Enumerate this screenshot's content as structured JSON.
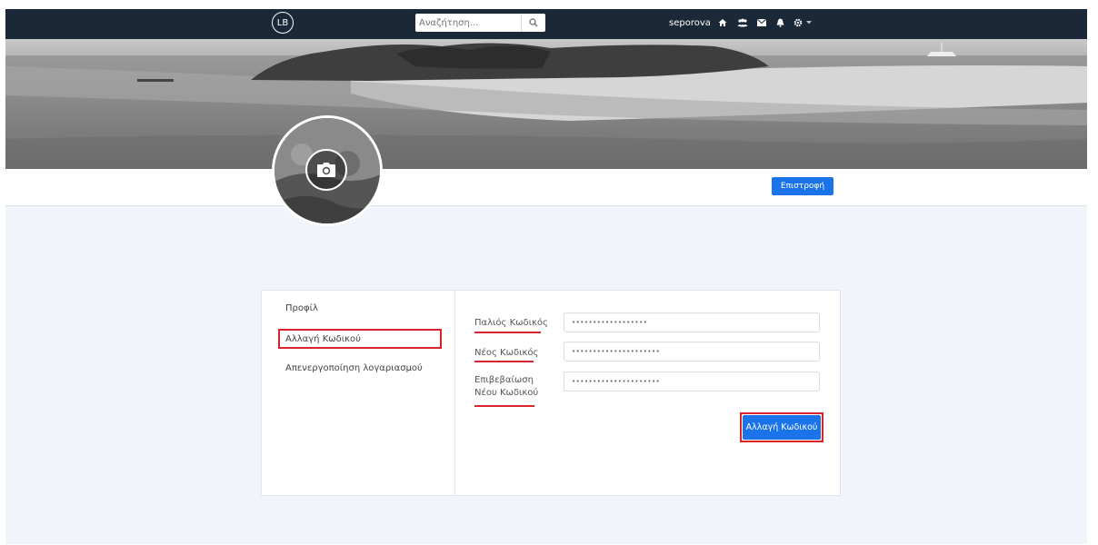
{
  "navbar": {
    "logo_text": "LB",
    "search": {
      "placeholder": "Αναζήτηση...",
      "icon": "search-icon"
    },
    "username": "seporova",
    "icons": [
      "home-icon",
      "users-icon",
      "envelope-icon",
      "bell-icon",
      "gear-icon",
      "caret-down-icon"
    ]
  },
  "header": {
    "back_label": "Επιστροφή",
    "avatar_icon": "camera-icon"
  },
  "sidebar": {
    "items": [
      {
        "label": "Προφίλ",
        "active": false
      },
      {
        "label": "Αλλαγή Κωδικού",
        "active": true
      },
      {
        "label": "Απενεργοποίηση λογαριασμού",
        "active": false
      }
    ]
  },
  "form": {
    "old_password": {
      "label": "Παλιός Κωδικός",
      "value": "••••••••••••••••••"
    },
    "new_password": {
      "label": "Νέος Κωδικός",
      "value": "•••••••••••••••••••••"
    },
    "confirm_password": {
      "label_line1": "Επιβεβαίωση",
      "label_line2": "Νέου Κωδικού",
      "value": "•••••••••••••••••••••"
    },
    "submit_label": "Αλλαγή Κωδικού"
  },
  "colors": {
    "navbar": "#1b2837",
    "primary": "#1a73e8",
    "highlight": "#d9232d",
    "page_bg": "#f1f5fb"
  }
}
